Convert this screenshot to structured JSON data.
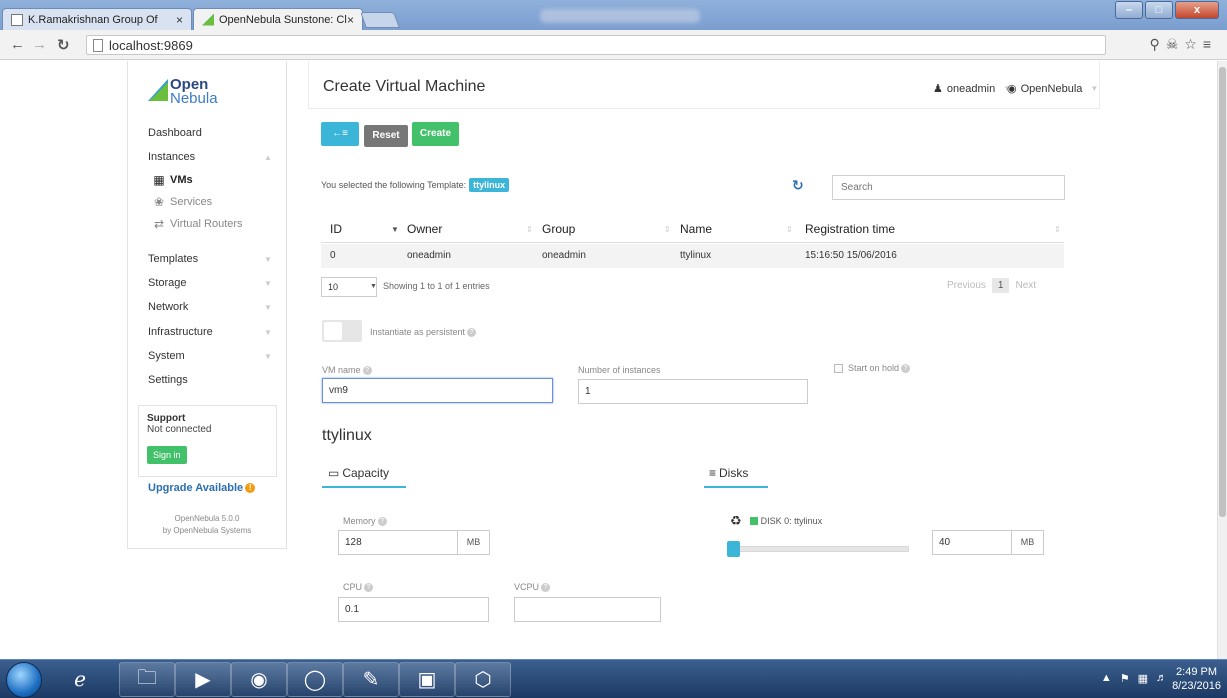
{
  "browser": {
    "tabs": [
      {
        "title": "K.Ramakrishnan Group Of",
        "close": "×"
      },
      {
        "title": "OpenNebula Sunstone: Cl",
        "close": "×"
      }
    ],
    "url": "localhost:9869",
    "window_buttons": {
      "minimize": "–",
      "maximize": "□",
      "close": "x"
    }
  },
  "sidebar": {
    "logo_line1": "Open",
    "logo_line2": "Nebula",
    "menu": {
      "dashboard": "Dashboard",
      "instances": "Instances",
      "vms": "VMs",
      "services": "Services",
      "virtual_routers": "Virtual Routers",
      "templates": "Templates",
      "storage": "Storage",
      "network": "Network",
      "infrastructure": "Infrastructure",
      "system": "System",
      "settings": "Settings"
    },
    "support": {
      "title": "Support",
      "status": "Not connected",
      "signin": "Sign in"
    },
    "upgrade": "Upgrade Available",
    "version_line1": "OpenNebula 5.0.0",
    "version_line2": "by OpenNebula Systems"
  },
  "header": {
    "title": "Create Virtual Machine",
    "user": "oneadmin",
    "zone": "OpenNebula"
  },
  "toolbar": {
    "back": "←≡",
    "reset": "Reset",
    "create": "Create"
  },
  "template_select": {
    "text": "You selected the following Template:",
    "label": "ttylinux",
    "search_placeholder": "Search"
  },
  "table": {
    "columns": [
      "ID",
      "Owner",
      "Group",
      "Name",
      "Registration time"
    ],
    "rows": [
      {
        "id": "0",
        "owner": "oneadmin",
        "group": "oneadmin",
        "name": "ttylinux",
        "registration": "15:16:50 15/06/2016"
      }
    ],
    "page_length": "10",
    "info": "Showing 1 to 1 of 1 entries",
    "previous": "Previous",
    "page": "1",
    "next": "Next"
  },
  "form": {
    "persistent_label": "Instantiate as persistent",
    "vm_name_label": "VM name",
    "vm_name_value": "vm9",
    "instances_label": "Number of instances",
    "instances_value": "1",
    "hold_label": "Start on hold"
  },
  "template_section": {
    "title": "ttylinux",
    "capacity_tab": "Capacity",
    "disks_tab": "Disks",
    "memory_label": "Memory",
    "memory_value": "128",
    "memory_unit": "MB",
    "cpu_label": "CPU",
    "cpu_value": "0.1",
    "vcpu_label": "VCPU",
    "vcpu_value": "",
    "disk_label": "DISK 0: ttylinux",
    "disk_size_value": "40",
    "disk_size_unit": "MB",
    "disk_slider_fraction": 0.0
  },
  "taskbar": {
    "time": "2:49 PM",
    "date": "8/23/2016"
  },
  "colors": {
    "accent_blue": "#3bb5d8",
    "create_green": "#43c06a",
    "reset_gray": "#777777"
  }
}
